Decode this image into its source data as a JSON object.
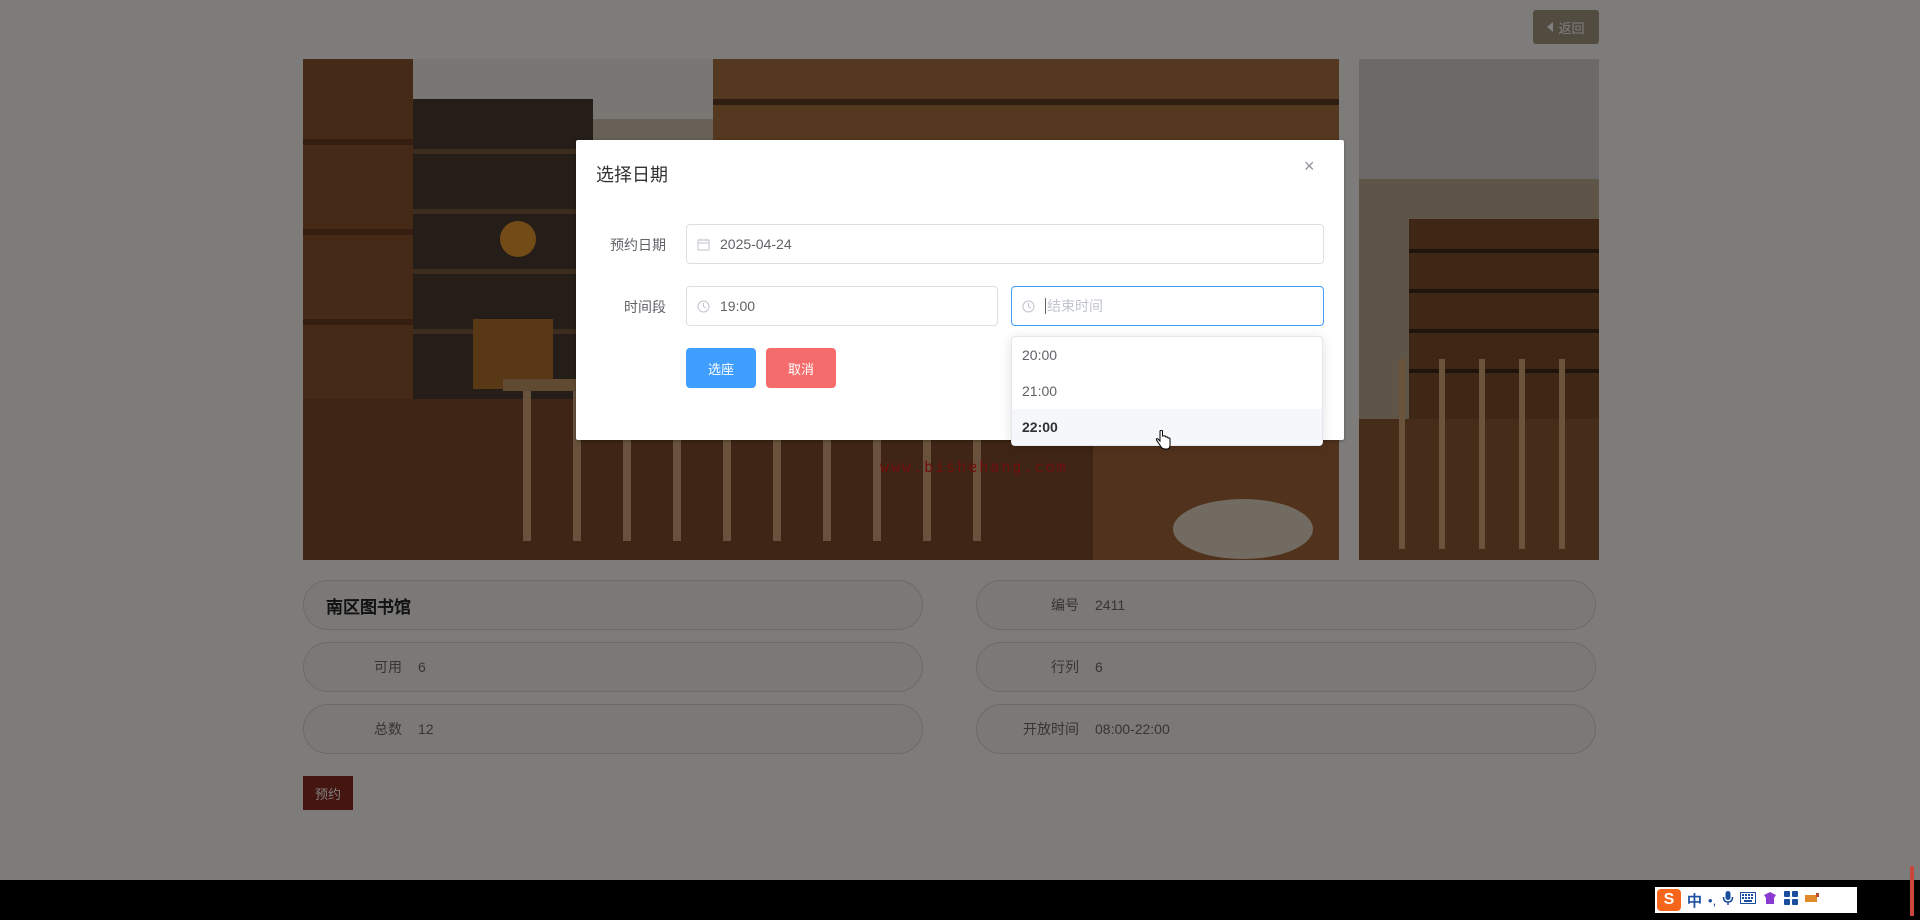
{
  "header": {
    "back_label": "返回"
  },
  "venue": {
    "name": "南区图书馆",
    "fields": [
      {
        "key": "可用",
        "value": "6"
      },
      {
        "key": "总数",
        "value": "12"
      },
      {
        "key": "编号",
        "value": "2411"
      },
      {
        "key": "行列",
        "value": "6"
      },
      {
        "key": "开放时间",
        "value": "08:00-22:00"
      }
    ],
    "reserve_label": "预约"
  },
  "watermark": "www.bishehang.com",
  "modal": {
    "title": "选择日期",
    "close_glyph": "×",
    "date_label": "预约日期",
    "date_value": "2025-04-24",
    "time_label": "时间段",
    "start_time": "19:00",
    "end_placeholder": "结束时间",
    "confirm_label": "选座",
    "cancel_label": "取消"
  },
  "time_options": [
    {
      "label": "20:00",
      "hovered": false
    },
    {
      "label": "21:00",
      "hovered": false
    },
    {
      "label": "22:00",
      "hovered": true
    }
  ],
  "taskbar": {
    "ime_mode": "中",
    "ime_punct": "•,",
    "ime_logo": "S"
  },
  "colors": {
    "primary": "#409eff",
    "danger": "#f56c6c",
    "reserve": "#8b2a1e",
    "back_button": "#a3997f",
    "watermark": "#e11d1d"
  },
  "icons": [
    "calendar-icon",
    "clock-icon",
    "close-icon",
    "back-arrow-icon",
    "hand-cursor-icon",
    "mic-icon",
    "keyboard-icon",
    "skin-icon",
    "apps-icon",
    "tools-icon"
  ]
}
